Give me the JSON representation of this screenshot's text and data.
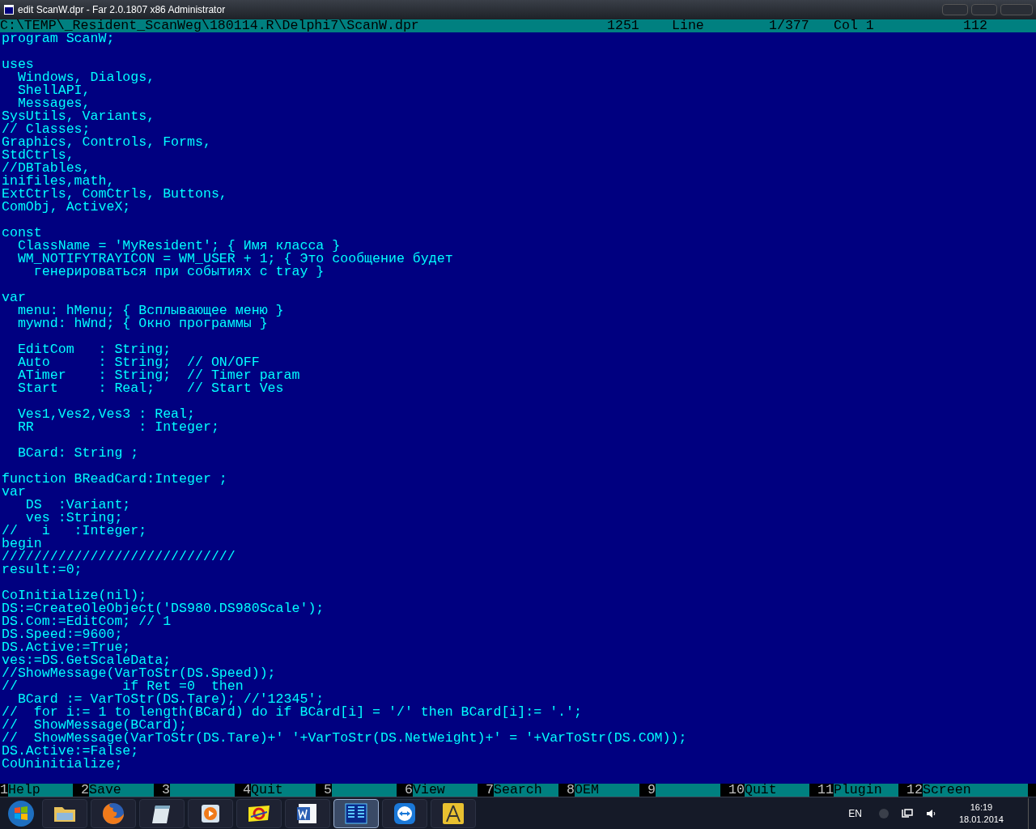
{
  "window": {
    "title": "edit ScanW.dpr - Far 2.0.1807 x86 Administrator"
  },
  "status_bar": {
    "path": "C:\\TEMP\\_Resident_ScanWeg\\180114.R\\Delphi7\\ScanW.dpr",
    "codepage": "1251",
    "line_label": "Line",
    "line": "1/377",
    "col": "Col 1",
    "column_6": "112"
  },
  "code_blocks": [
    [
      "program ScanW;"
    ],
    [
      "uses",
      "  Windows, Dialogs,",
      "  ShellAPI,",
      "  Messages,",
      "SysUtils, Variants,",
      "// Classes;",
      "Graphics, Controls, Forms,",
      "StdCtrls,",
      "//DBTables,",
      "inifiles,math,",
      "ExtCtrls, ComCtrls, Buttons,",
      "ComObj, ActiveX;"
    ],
    [
      "const",
      "  ClassName = 'MyResident'; { Имя класса }",
      "  WM_NOTIFYTRAYICON = WM_USER + 1; { Это сообщение будет",
      "    генерироваться при событиях с tray }"
    ],
    [
      "var",
      "  menu: hMenu; { Всплывающее меню }",
      "  mywnd: hWnd; { Окно программы }"
    ],
    [
      "  EditCom   : String;",
      "  Auto      : String;  // ON/OFF",
      "  ATimer    : String;  // Timer param",
      "  Start     : Real;    // Start Ves"
    ],
    [
      "  Ves1,Ves2,Ves3 : Real;",
      "  RR             : Integer;"
    ],
    [
      "  BCard: String ;"
    ],
    [
      "function BReadCard:Integer ;",
      "var",
      "   DS  :Variant;",
      "   ves :String;",
      "//   i   :Integer;",
      "begin",
      "/////////////////////////////",
      "result:=0;"
    ],
    [
      "CoInitialize(nil);",
      "DS:=CreateOleObject('DS980.DS980Scale');",
      "DS.Com:=EditCom; // 1",
      "DS.Speed:=9600;",
      "DS.Active:=True;",
      "ves:=DS.GetScaleData;",
      "//ShowMessage(VarToStr(DS.Speed));",
      "//             if Ret =0  then",
      "  BCard := VarToStr(DS.Tare); //'12345';",
      "//  for i:= 1 to length(BCard) do if BCard[i] = '/' then BCard[i]:= '.';",
      "//  ShowMessage(BCard);",
      "//  ShowMessage(VarToStr(DS.Tare)+' '+VarToStr(DS.NetWeight)+' = '+VarToStr(DS.COM));",
      "DS.Active:=False;",
      "CoUninitialize;"
    ]
  ],
  "keybar": [
    {
      "number": "1",
      "label": "Help"
    },
    {
      "number": "2",
      "label": "Save"
    },
    {
      "number": "3"
    },
    {
      "number": "4",
      "label": "Quit"
    },
    {
      "number": "5"
    },
    {
      "number": "6",
      "label": "View"
    },
    {
      "number": "7",
      "label": "Search"
    },
    {
      "number": "8",
      "label": "OEM"
    },
    {
      "number": "9"
    },
    {
      "number": "10",
      "label": "Quit"
    },
    {
      "number": "11",
      "label": "Plugin"
    },
    {
      "number": "12",
      "label": "Screen"
    }
  ],
  "taskbar": {
    "apps": [
      {
        "selected": false
      },
      {
        "selected": false
      },
      {
        "selected": false
      },
      {
        "selected": false
      },
      {
        "selected": false
      },
      {
        "selected": false
      },
      {
        "selected": true
      },
      {
        "selected": false
      },
      {
        "selected": false
      }
    ],
    "language": "EN",
    "time": "16:19",
    "date": "18.01.2014"
  }
}
